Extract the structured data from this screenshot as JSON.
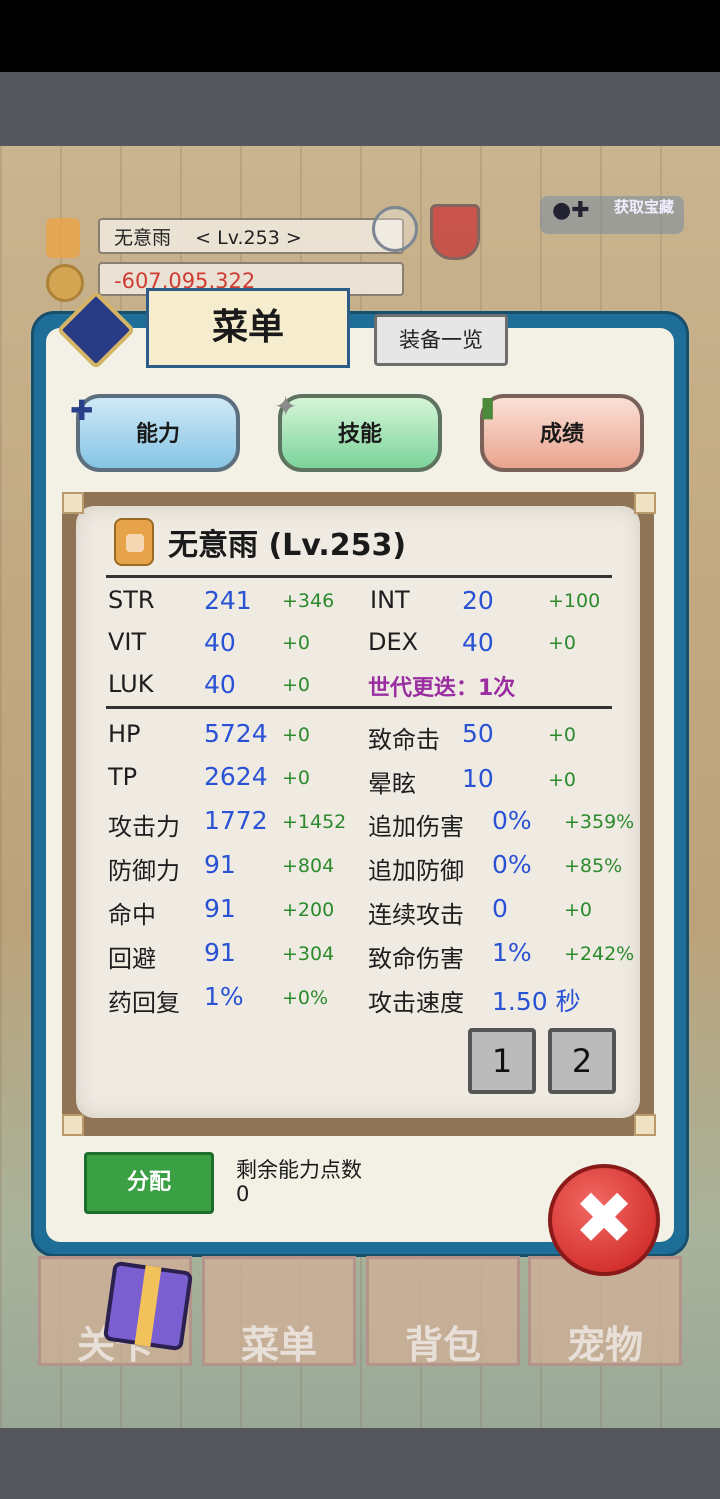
{
  "hud": {
    "name_level": "无意雨    < Lv.253 >",
    "gold": "-607,095,322",
    "top_right_label": "获取宝藏"
  },
  "menu": {
    "title": "菜单",
    "equip_list": "装备一览"
  },
  "tabs": [
    {
      "label": "能力"
    },
    {
      "label": "技能"
    },
    {
      "label": "成绩"
    }
  ],
  "character": {
    "title": "无意雨 (Lv.253)"
  },
  "stats_primary": [
    {
      "label": "STR",
      "value": "241",
      "bonus": "+346"
    },
    {
      "label": "INT",
      "value": "20",
      "bonus": "+100"
    },
    {
      "label": "VIT",
      "value": "40",
      "bonus": "+0"
    },
    {
      "label": "DEX",
      "value": "40",
      "bonus": "+0"
    },
    {
      "label": "LUK",
      "value": "40",
      "bonus": "+0"
    }
  ],
  "generation": "世代更迭：1次",
  "stats_secondary": [
    {
      "label": "HP",
      "value": "5724",
      "bonus": "+0"
    },
    {
      "label": "致命击",
      "value": "50",
      "bonus": "+0"
    },
    {
      "label": "TP",
      "value": "2624",
      "bonus": "+0"
    },
    {
      "label": "晕眩",
      "value": "10",
      "bonus": "+0"
    },
    {
      "label": "攻击力",
      "value": "1772",
      "bonus": "+1452"
    },
    {
      "label": "追加伤害",
      "value": "0%",
      "bonus": "+359%"
    },
    {
      "label": "防御力",
      "value": "91",
      "bonus": "+804"
    },
    {
      "label": "追加防御",
      "value": "0%",
      "bonus": "+85%"
    },
    {
      "label": "命中",
      "value": "91",
      "bonus": "+200"
    },
    {
      "label": "连续攻击",
      "value": "0",
      "bonus": "+0"
    },
    {
      "label": "回避",
      "value": "91",
      "bonus": "+304"
    },
    {
      "label": "致命伤害",
      "value": "1%",
      "bonus": "+242%"
    },
    {
      "label": "药回复",
      "value": "1%",
      "bonus": "+0%"
    },
    {
      "label": "攻击速度",
      "value": "1.50 秒"
    }
  ],
  "pages": [
    "1",
    "2"
  ],
  "assign": {
    "button": "分配",
    "remaining_label": "剩余能力点数",
    "remaining_value": "0"
  },
  "close_glyph": "✖",
  "nav": [
    "关卡",
    "菜单",
    "背包",
    "宠物"
  ],
  "colors": {
    "stat_value": "#2a52d4",
    "stat_bonus": "#2c8a2c",
    "generation": "#9a2da0",
    "panel_border": "#1f6e97"
  }
}
